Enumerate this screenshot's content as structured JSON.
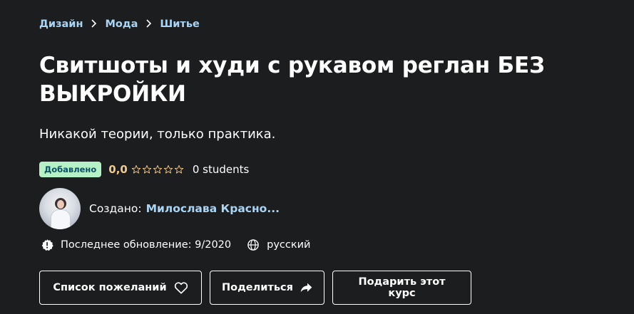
{
  "breadcrumb": {
    "items": [
      "Дизайн",
      "Мода",
      "Шитье"
    ]
  },
  "course": {
    "title": "Свитшоты и худи с рукавом реглан БЕЗ ВЫКРОЙКИ",
    "subtitle": "Никакой теории, только практика.",
    "badge": "Добавлено",
    "rating": "0,0",
    "rating_stars": 0,
    "students": "0 students"
  },
  "author": {
    "created_label": "Создано:",
    "name": "Милослава Красно..."
  },
  "meta": {
    "updated": "Последнее обновление: 9/2020",
    "language": "русский"
  },
  "actions": {
    "wishlist": "Список пожеланий",
    "share": "Поделиться",
    "gift": "Подарить этот курс"
  },
  "colors": {
    "background": "#1c1d1f",
    "link": "#a9d4f3",
    "rating": "#f3ca8c",
    "badge_bg": "#b5f0c6",
    "badge_text": "#0d5261"
  },
  "icons": {
    "chevron": "chevron-right-icon",
    "star": "star-outline-icon",
    "update": "alert-badge-icon",
    "language": "globe-icon",
    "wishlist": "heart-icon",
    "share": "share-arrow-icon"
  }
}
